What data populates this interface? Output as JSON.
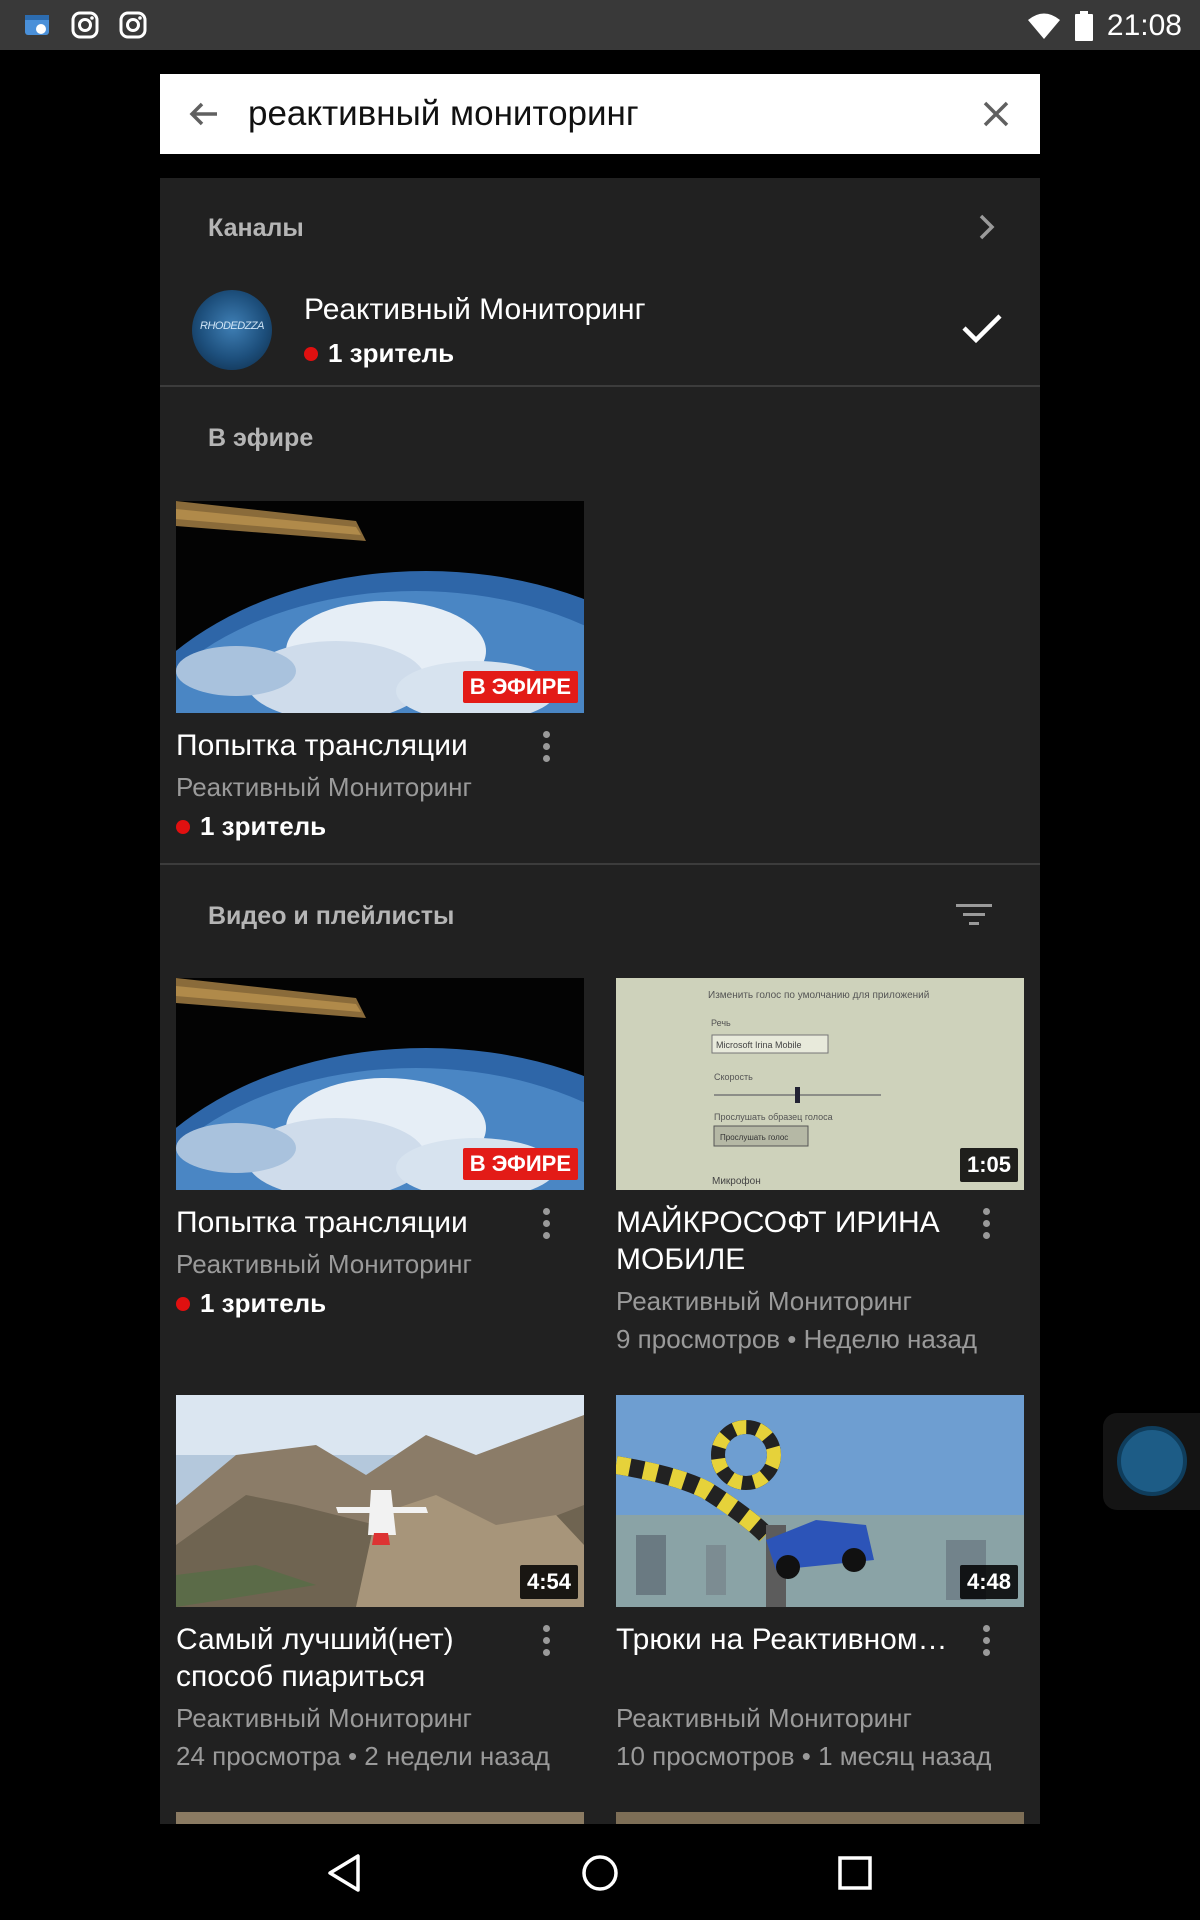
{
  "status_bar": {
    "time": "21:08",
    "left_icons": [
      "app-notification-icon",
      "instagram-icon",
      "instagram-icon"
    ],
    "right_icons": [
      "wifi-icon",
      "battery-icon"
    ]
  },
  "search": {
    "query": "реактивный мониторинг",
    "back_icon": "arrow-back-icon",
    "clear_icon": "close-icon"
  },
  "channels": {
    "title": "Каналы",
    "channel": {
      "name": "Реактивный Мониторинг",
      "viewers": "1 зритель",
      "avatar_text": "RHODEDZZA",
      "subscribed": true
    }
  },
  "live": {
    "title": "В эфире",
    "video": {
      "title": "Попытка трансляции",
      "channel": "Реактивный Мониторинг",
      "viewers": "1 зритель",
      "badge": "В ЭФИРЕ"
    }
  },
  "videos": {
    "title": "Видео и плейлисты",
    "items": [
      {
        "title": "Попытка трансляции",
        "channel": "Реактивный Мониторинг",
        "viewers": "1 зритель",
        "badge": "В ЭФИРЕ"
      },
      {
        "title": "МАЙКРОСОФТ ИРИНА МОБИЛЕ",
        "channel": "Реактивный Мониторинг",
        "meta": "9 просмотров • Неделю назад",
        "duration": "1:05",
        "thumb_text": {
          "l1": "Изменить голос по умолчанию для приложений",
          "l2": "Речь",
          "l3": "Microsoft Irina Mobile",
          "l4": "Скорость",
          "l5": "Прослушать образец голоса",
          "l6": "Прослушать голос",
          "l7": "Микрофон"
        }
      },
      {
        "title": "Самый лучший(нет) способ пиариться",
        "channel": "Реактивный Мониторинг",
        "meta": "24 просмотра • 2 недели назад",
        "duration": "4:54"
      },
      {
        "title": "Трюки на Реактивном…",
        "channel": "Реактивный Мониторинг",
        "meta": "10 просмотров • 1 месяц назад",
        "duration": "4:48"
      }
    ]
  },
  "nav": {
    "back_icon": "nav-back-icon",
    "home_icon": "nav-home-icon",
    "recents_icon": "nav-recents-icon"
  }
}
